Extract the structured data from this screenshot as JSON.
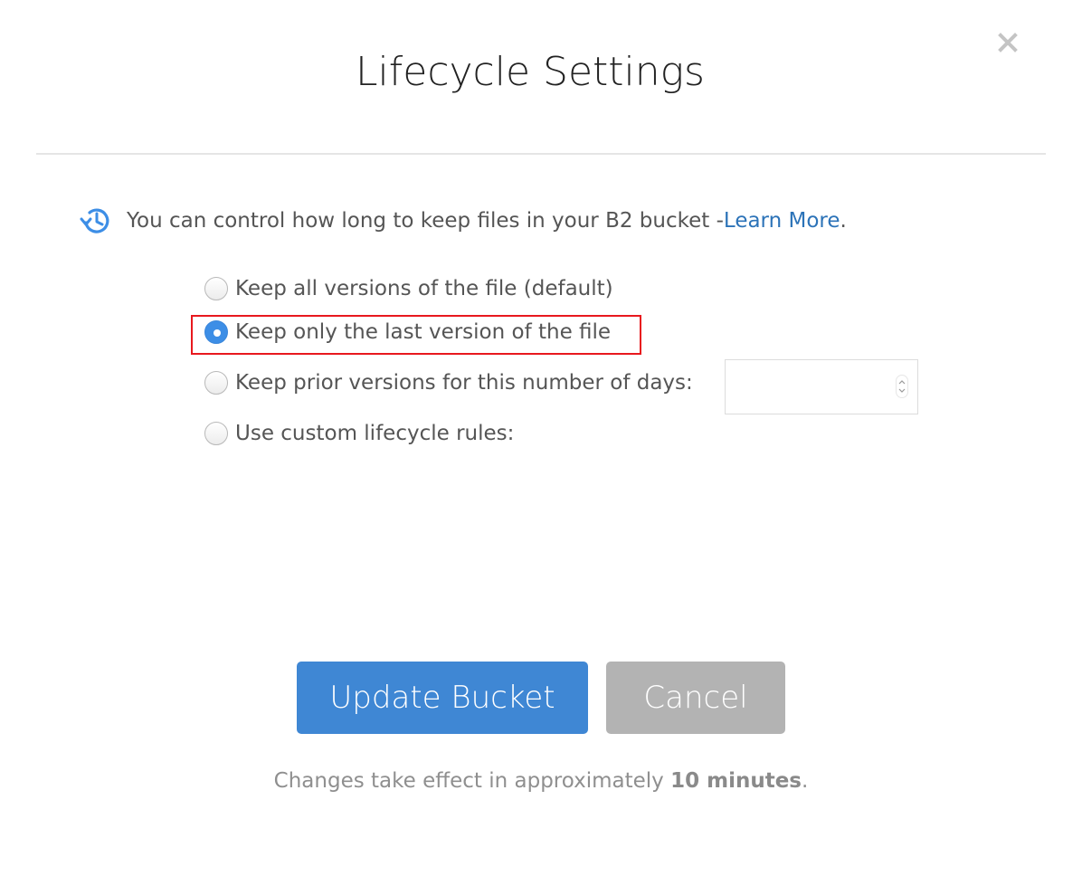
{
  "dialog": {
    "title": "Lifecycle Settings",
    "close_icon": "close-icon"
  },
  "intro": {
    "icon": "history-clock-icon",
    "text": "You can control how long to keep files in your B2 bucket - ",
    "link_label": "Learn More",
    "suffix": "."
  },
  "options": [
    {
      "label": "Keep all versions of the file (default)",
      "checked": false
    },
    {
      "label": "Keep only the last version of the file",
      "checked": true
    },
    {
      "label": "Keep prior versions for this number of days:",
      "checked": false
    },
    {
      "label": "Use custom lifecycle rules:",
      "checked": false
    }
  ],
  "days_input": {
    "value": "",
    "placeholder": ""
  },
  "buttons": {
    "update_label": "Update Bucket",
    "cancel_label": "Cancel"
  },
  "footnote": {
    "text": "Changes take effect in approximately ",
    "bold": "10 minutes",
    "suffix": "."
  },
  "colors": {
    "accent": "#3f87d4",
    "link": "#2c73b8",
    "highlight": "#e8181e",
    "cancel": "#b3b3b3"
  }
}
